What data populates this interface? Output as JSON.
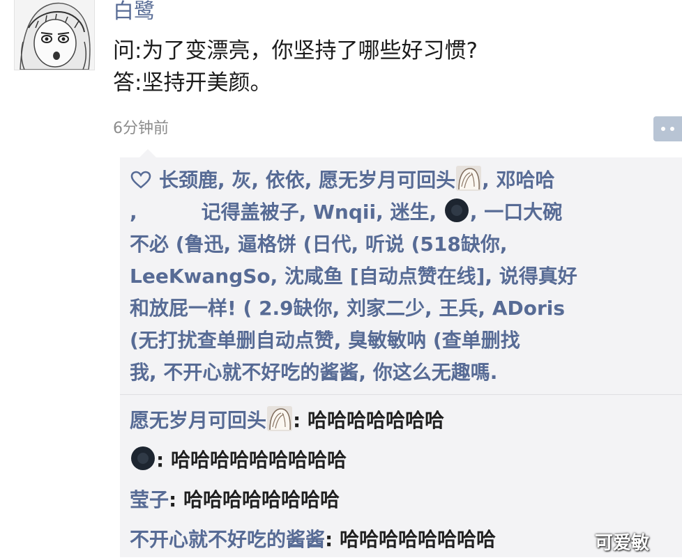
{
  "post": {
    "username": "白鹭",
    "text_line_1": "问:为了变漂亮，你坚持了哪些好习惯?",
    "text_line_2": "答:坚持开美颜。",
    "timestamp": "6分钟前",
    "more_icon": "more-dots-icon"
  },
  "likes": {
    "icon": "heart-outline-icon",
    "row1_a": "长颈鹿, 灰, 依依, 愿无岁月可回头",
    "row1_b": ", 邓哈哈",
    "row2_a": ",",
    "row2_b": "记得盖被子, Wnqii, 迷生,",
    "row2_c": ", 一口大碗",
    "row3": "不必 (鲁迅, 逼格饼 (日代, 听说 (518缺你,",
    "row4": "LeeKwangSo, 沈咸鱼 [自动点赞在线], 说得真好",
    "row5": "和放屁一样! ( 2.9缺你, 刘家二少, 王兵, ADoris",
    "row6": "(无打扰查单删自动点赞, 臭敏敏呐 (查单删找",
    "row7": "我, 不开心就不好吃的酱酱, 你这么无趣嗎."
  },
  "comments": [
    {
      "author": "愿无岁月可回头",
      "separator": ": ",
      "text": "哈哈哈哈哈哈哈"
    },
    {
      "author": "",
      "separator": ": ",
      "text": "哈哈哈哈哈哈哈哈哈"
    },
    {
      "author": "莹子",
      "separator": ": ",
      "text": "哈哈哈哈哈哈哈哈"
    },
    {
      "author": "不开心就不好吃的酱酱",
      "separator": ": ",
      "text": "哈哈哈哈哈哈哈哈"
    }
  ],
  "watermark": "可爱敏",
  "colors": {
    "name_blue": "#576b95",
    "box_bg": "#f3f3f5",
    "timestamp_gray": "#8c8c8c"
  }
}
